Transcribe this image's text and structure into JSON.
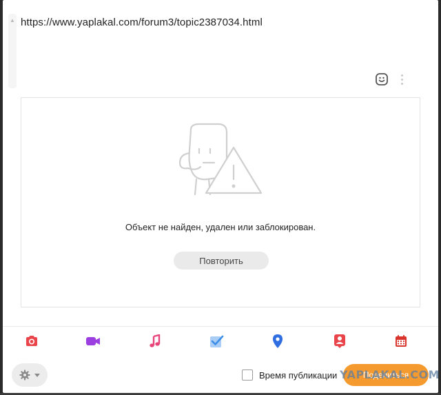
{
  "post": {
    "text": "https://www.yaplakal.com/forum3/topic2387034.html"
  },
  "embed": {
    "error_message": "Объект не найден, удален или заблокирован.",
    "retry_label": "Повторить"
  },
  "media_bar": {
    "icons": [
      "camera-icon",
      "video-icon",
      "music-icon",
      "poll-icon",
      "location-icon",
      "contact-icon",
      "calendar-icon"
    ],
    "colors": {
      "camera": "#e8444a",
      "video": "#9b3fe0",
      "music": "#e8447a",
      "poll": "#3d8ee8",
      "location": "#2f6ee0",
      "contact": "#e8444a",
      "calendar": "#d9342b"
    }
  },
  "footer": {
    "schedule_label": "Время публикации",
    "publish_label": "Поделиться",
    "publish_color": "#f59a2f"
  },
  "watermark": {
    "text": "YAPLAKAL.COM"
  }
}
